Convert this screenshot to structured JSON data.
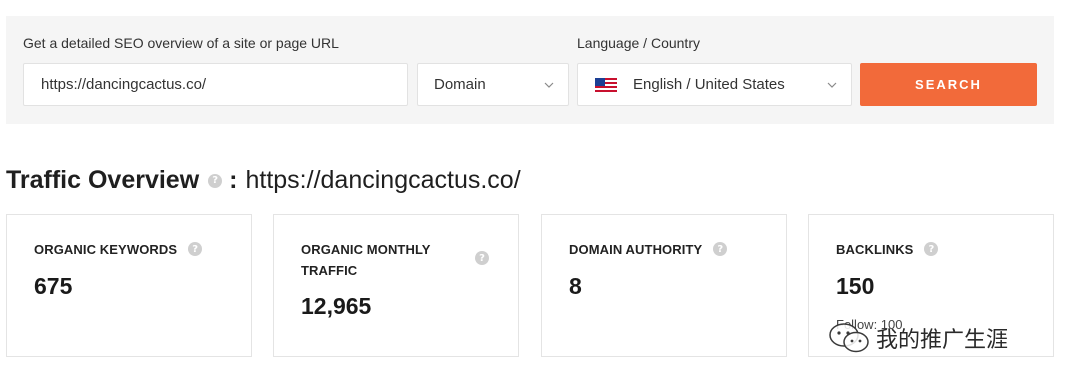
{
  "search": {
    "url_label": "Get a detailed SEO overview of a site or page URL",
    "url_value": "https://dancingcactus.co/",
    "type_value": "Domain",
    "lang_label": "Language / Country",
    "lang_value": "English / United States",
    "button_label": "SEARCH"
  },
  "overview": {
    "title": "Traffic Overview",
    "colon": ":",
    "url": "https://dancingcactus.co/"
  },
  "cards": [
    {
      "title": "ORGANIC KEYWORDS",
      "value": "675"
    },
    {
      "title": "ORGANIC MONTHLY TRAFFIC",
      "value": "12,965"
    },
    {
      "title": "DOMAIN AUTHORITY",
      "value": "8"
    },
    {
      "title": "BACKLINKS",
      "value": "150",
      "sub": "Follow: 100"
    }
  ],
  "watermark": {
    "text": "我的推广生涯"
  },
  "colors": {
    "accent": "#f26a3a",
    "panel": "#f5f5f5"
  },
  "icons": {
    "help": "question-circle-icon",
    "chevron": "chevron-down-icon",
    "flag": "us-flag-icon"
  }
}
